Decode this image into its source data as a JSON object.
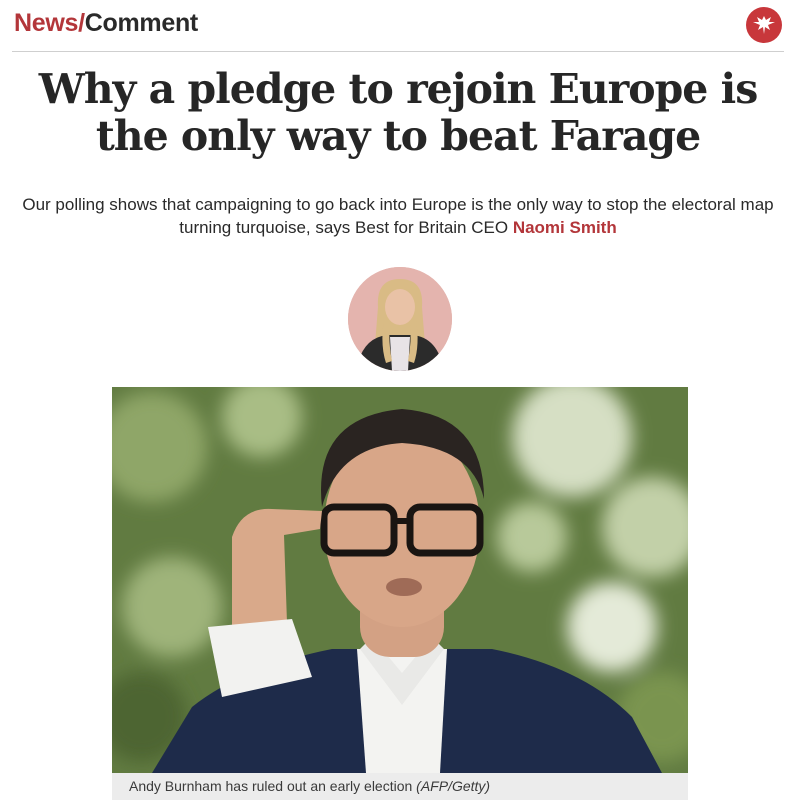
{
  "header": {
    "section_primary": "News",
    "section_separator": "/",
    "section_secondary": "Comment",
    "logo_icon": "eagle-icon",
    "accent_color": "#b3363a"
  },
  "article": {
    "headline": "Why a pledge to rejoin Europe is the only way to beat Farage",
    "standfirst": "Our polling shows that campaigning to go back into Europe is the only way to stop the electoral map turning turquoise, says Best for Britain CEO ",
    "author_name": "Naomi Smith"
  },
  "media": {
    "caption": "Andy Burnham has ruled out an early election ",
    "credit": "(AFP/Getty)"
  }
}
